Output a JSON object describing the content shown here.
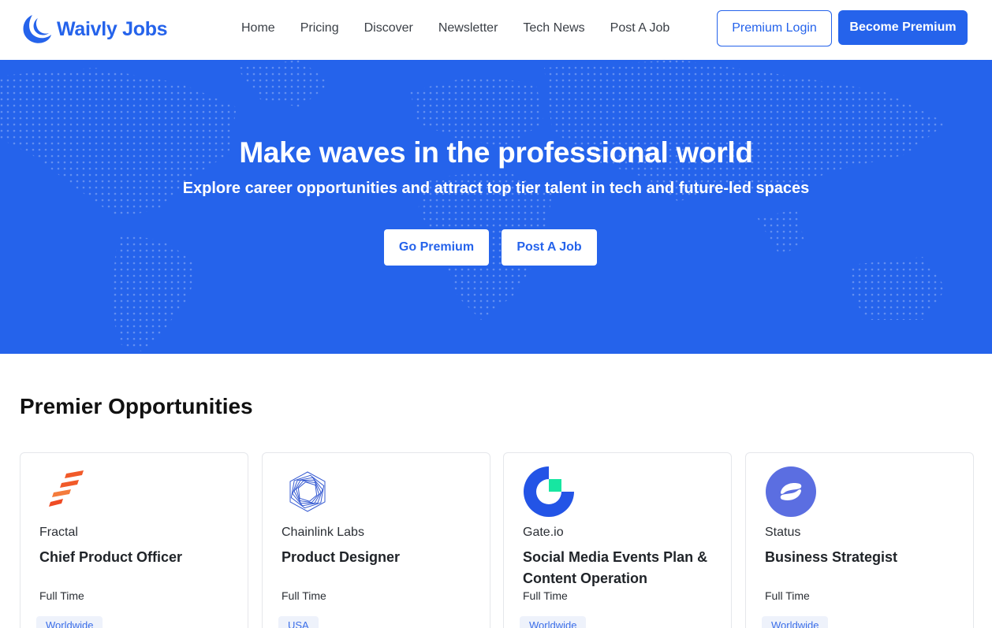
{
  "header": {
    "brand": "Waivly Jobs",
    "nav": [
      "Home",
      "Pricing",
      "Discover",
      "Newsletter",
      "Tech News",
      "Post A Job"
    ],
    "premium_login": "Premium Login",
    "become_premium": "Become Premium"
  },
  "hero": {
    "title": "Make waves in the professional world",
    "subtitle": "Explore career opportunities and attract top tier talent in tech and future-led spaces",
    "go_premium": "Go Premium",
    "post_job": "Post A Job"
  },
  "section": {
    "title": "Premier Opportunities"
  },
  "colors": {
    "brand": "#2563eb",
    "tag_bg": "#eef2fb"
  },
  "jobs": [
    {
      "company": "Fractal",
      "title": "Chief Product Officer",
      "type": "Full Time",
      "location": "Worldwide",
      "logo": "fractal-logo"
    },
    {
      "company": "Chainlink Labs",
      "title": "Product Designer",
      "type": "Full Time",
      "location": "USA",
      "logo": "chainlink-logo"
    },
    {
      "company": "Gate.io",
      "title": "Social Media Events Plan & Content Operation",
      "type": "Full Time",
      "location": "Worldwide",
      "logo": "gateio-logo"
    },
    {
      "company": "Status",
      "title": "Business Strategist",
      "type": "Full Time",
      "location": "Worldwide",
      "logo": "status-logo"
    }
  ]
}
